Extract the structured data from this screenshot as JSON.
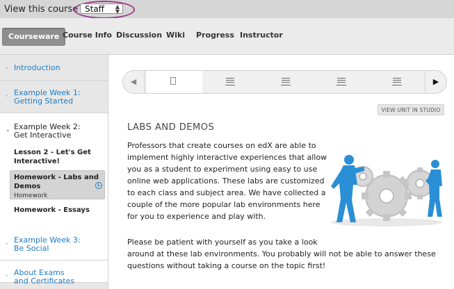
{
  "viewbar": {
    "label": "View this course as:",
    "select_value": "Staff"
  },
  "tabs": [
    {
      "label": "Courseware"
    },
    {
      "label": "Course Info"
    },
    {
      "label": "Discussion"
    },
    {
      "label": "Wiki"
    },
    {
      "label": "Progress"
    },
    {
      "label": "Instructor"
    }
  ],
  "sidebar": {
    "chapters": [
      {
        "label": "Introduction"
      },
      {
        "label_line1": "Example Week 1:",
        "label_line2": "Getting Started"
      },
      {
        "label_line1": "Example Week 2:",
        "label_line2": "Get Interactive"
      },
      {
        "label_line1": "Example Week 3:",
        "label_line2": "Be Social"
      },
      {
        "label_line1": "About Exams",
        "label_line2": "and Certificates"
      }
    ],
    "sections": [
      {
        "line1": "Lesson 2 - Let's Get",
        "line2": "Interactive!"
      },
      {
        "line1": "Homework - Labs and",
        "line2": "Demos",
        "sub": "Homework"
      },
      {
        "line1": "Homework - Essays"
      }
    ]
  },
  "main": {
    "studio_button": "VIEW UNIT IN STUDIO",
    "unit_title": "LABS AND DEMOS",
    "para1_lines": [
      "Professors that create courses on edX are able to",
      "implement highly interactive experiences that allow",
      "you as a student to experiment using easy to use",
      "online web applications. These labs are customized",
      "to each class and subject area. We have collected a",
      "couple of the more popular lab environments here",
      "for you to experience and play with."
    ],
    "para2_lines": [
      "Please be patient with yourself as you take a look",
      "around at these lab environments. You probably will not be able to answer these",
      "questions without taking a course on the topic first!"
    ]
  },
  "icons": {
    "seq_prev": "left-triangle-icon",
    "seq_next": "right-triangle-icon",
    "page": "page-icon",
    "list": "list-icon",
    "due": "alarm-clock-icon"
  },
  "colors": {
    "link": "#1d7bc4",
    "active_tab": "#8f8f8f",
    "highlight_ring": "#9b3d8c"
  }
}
